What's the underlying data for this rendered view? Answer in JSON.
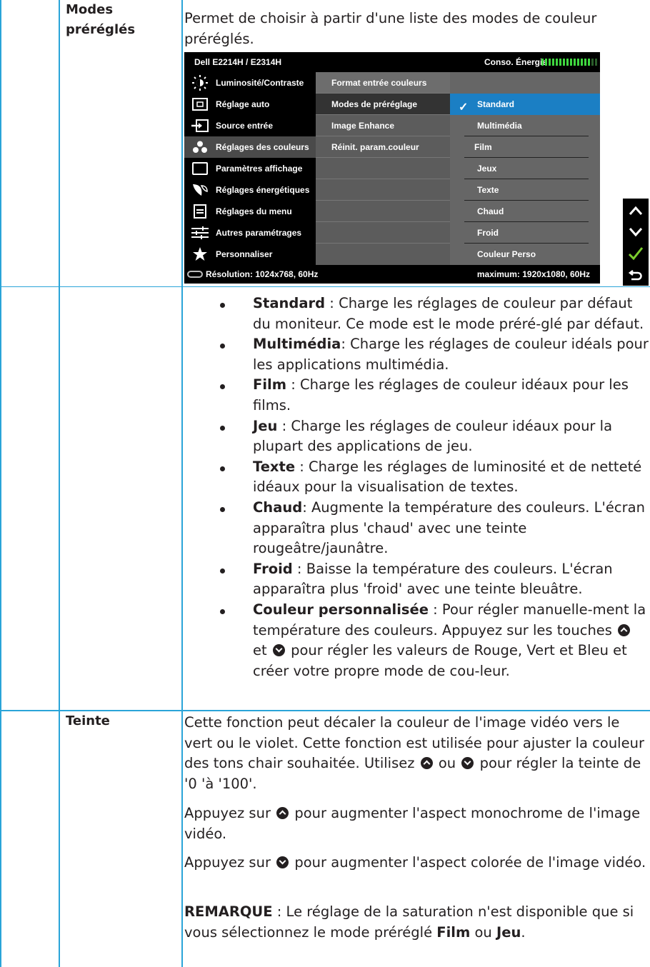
{
  "rows": {
    "modes": {
      "label": "Modes\npréréglés",
      "intro": "Permet de choisir à partir d'une liste des modes de couleur préréglés."
    },
    "teinte": {
      "label": "Teinte",
      "p1": "Cette fonction peut décaler la couleur de l'image vidéo vers le vert ou le violet. Cette fonction est utilisée pour ajuster la couleur des tons chair souhaitée. Utilisez",
      "p1_or": "ou",
      "p1_end": "pour régler la teinte de '0 'à '100'.",
      "p2_a": "Appuyez sur",
      "p2_b": "pour augmenter l'aspect monochrome de l'image vidéo.",
      "p3_a": "Appuyez sur",
      "p3_b": "pour augmenter l'aspect colorée de l'image vidéo.",
      "note_label": "REMARQUE",
      "note_a": " : Le réglage de la saturation n'est disponible que si vous sélectionnez le mode préréglé ",
      "note_film": "Film",
      "note_ou": " ou ",
      "note_jeu": "Jeu",
      "note_end": "."
    }
  },
  "osd": {
    "title": "Dell E2214H / E2314H",
    "power_label": "Conso. Énergie",
    "power_level": 0.85,
    "left_menu": [
      {
        "label": "Luminosité/Contraste",
        "icon": "brightness-icon"
      },
      {
        "label": "Réglage auto",
        "icon": "auto-adjust-icon"
      },
      {
        "label": "Source entrée",
        "icon": "input-source-icon"
      },
      {
        "label": "Réglages des couleurs",
        "icon": "color-icon",
        "selected": true
      },
      {
        "label": "Paramètres affichage",
        "icon": "display-icon"
      },
      {
        "label": "Réglages énergétiques",
        "icon": "energy-icon"
      },
      {
        "label": "Réglages du menu",
        "icon": "menu-icon"
      },
      {
        "label": "Autres paramétrages",
        "icon": "other-settings-icon"
      },
      {
        "label": "Personnaliser",
        "icon": "star-icon"
      }
    ],
    "mid_menu": [
      "Format entrée couleurs",
      "Modes de préréglage",
      "Image Enhance",
      "Réinit. param.couleur"
    ],
    "right_menu": [
      "Standard",
      "Multimédia",
      "Film",
      "Jeux",
      "Texte",
      "Chaud",
      "Froid",
      "Couleur Perso"
    ],
    "selected_mode": "Standard",
    "resolution": "Résolution: 1024x768,  60Hz",
    "maximum": "maximum: 1920x1080,  60Hz"
  },
  "nav_buttons": [
    "up-icon",
    "down-icon",
    "check-icon",
    "back-icon"
  ],
  "bullets": [
    {
      "term": "Standard",
      "text": " : Charge les réglages de couleur par défaut du moniteur. Ce mode est le mode préré-glé par défaut."
    },
    {
      "term": "Multimédia",
      "text": ": Charge les réglages de couleur idéals pour les applications multimédia."
    },
    {
      "term": "Film",
      "text": " : Charge les réglages de couleur idéaux pour les films."
    },
    {
      "term": "Jeu",
      "text": " : Charge les réglages de couleur idéaux pour la plupart des applications de jeu."
    },
    {
      "term": "Texte",
      "text": " : Charge les réglages de luminosité et de netteté idéaux pour la visualisation de textes."
    },
    {
      "term": "Chaud",
      "text": ": Augmente la température des couleurs. L'écran apparaîtra plus 'chaud' avec une teinte rougeâtre/jaunâtre."
    },
    {
      "term": "Froid",
      "text": " : Baisse la température des couleurs. L'écran apparaîtra plus 'froid' avec une teinte bleuâtre."
    }
  ],
  "custom_bullet": {
    "term": "Couleur personnalisée",
    "text_a": " : Pour régler manuelle-ment la température des couleurs. Appuyez sur les touches",
    "text_et": "et",
    "text_b": "pour régler les valeurs de Rouge, Vert et Bleu et créer votre propre mode de cou-leur."
  },
  "colors": {
    "rule": "#2aa4d8",
    "osd_select": "#1b7fc4",
    "check_green": "#7ccd2e"
  }
}
